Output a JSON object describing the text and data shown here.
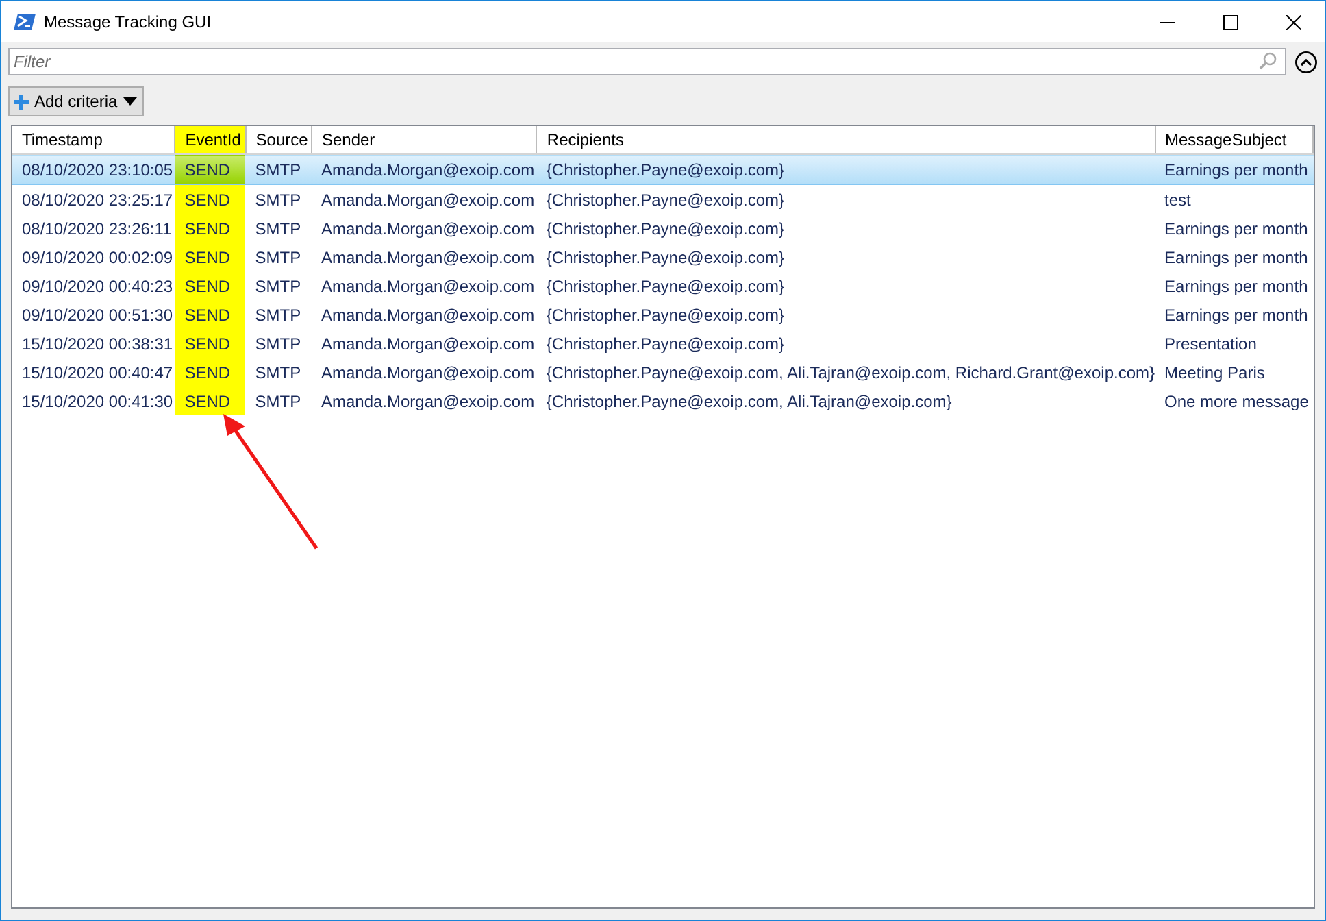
{
  "window": {
    "title": "Message Tracking GUI"
  },
  "filter": {
    "placeholder": "Filter"
  },
  "toolbar": {
    "add_criteria_button": "Add criteria"
  },
  "table": {
    "columns": [
      {
        "label": "Timestamp",
        "highlighted": false
      },
      {
        "label": "EventId",
        "highlighted": true
      },
      {
        "label": "Source",
        "highlighted": false
      },
      {
        "label": "Sender",
        "highlighted": false
      },
      {
        "label": "Recipients",
        "highlighted": false
      },
      {
        "label": "MessageSubject",
        "highlighted": false
      }
    ],
    "rows": [
      {
        "selected": true,
        "cells": [
          "08/10/2020 23:10:05",
          "SEND",
          "SMTP",
          "Amanda.Morgan@exoip.com",
          "{Christopher.Payne@exoip.com}",
          "Earnings per month"
        ]
      },
      {
        "selected": false,
        "cells": [
          "08/10/2020 23:25:17",
          "SEND",
          "SMTP",
          "Amanda.Morgan@exoip.com",
          "{Christopher.Payne@exoip.com}",
          "test"
        ]
      },
      {
        "selected": false,
        "cells": [
          "08/10/2020 23:26:11",
          "SEND",
          "SMTP",
          "Amanda.Morgan@exoip.com",
          "{Christopher.Payne@exoip.com}",
          "Earnings per month"
        ]
      },
      {
        "selected": false,
        "cells": [
          "09/10/2020 00:02:09",
          "SEND",
          "SMTP",
          "Amanda.Morgan@exoip.com",
          "{Christopher.Payne@exoip.com}",
          "Earnings per month"
        ]
      },
      {
        "selected": false,
        "cells": [
          "09/10/2020 00:40:23",
          "SEND",
          "SMTP",
          "Amanda.Morgan@exoip.com",
          "{Christopher.Payne@exoip.com}",
          "Earnings per month"
        ]
      },
      {
        "selected": false,
        "cells": [
          "09/10/2020 00:51:30",
          "SEND",
          "SMTP",
          "Amanda.Morgan@exoip.com",
          "{Christopher.Payne@exoip.com}",
          "Earnings per month"
        ]
      },
      {
        "selected": false,
        "cells": [
          "15/10/2020 00:38:31",
          "SEND",
          "SMTP",
          "Amanda.Morgan@exoip.com",
          "{Christopher.Payne@exoip.com}",
          "Presentation"
        ]
      },
      {
        "selected": false,
        "cells": [
          "15/10/2020 00:40:47",
          "SEND",
          "SMTP",
          "Amanda.Morgan@exoip.com",
          "{Christopher.Payne@exoip.com, Ali.Tajran@exoip.com, Richard.Grant@exoip.com}",
          "Meeting Paris"
        ]
      },
      {
        "selected": false,
        "cells": [
          "15/10/2020 00:41:30",
          "SEND",
          "SMTP",
          "Amanda.Morgan@exoip.com",
          "{Christopher.Payne@exoip.com, Ali.Tajran@exoip.com}",
          "One more message"
        ]
      }
    ]
  }
}
